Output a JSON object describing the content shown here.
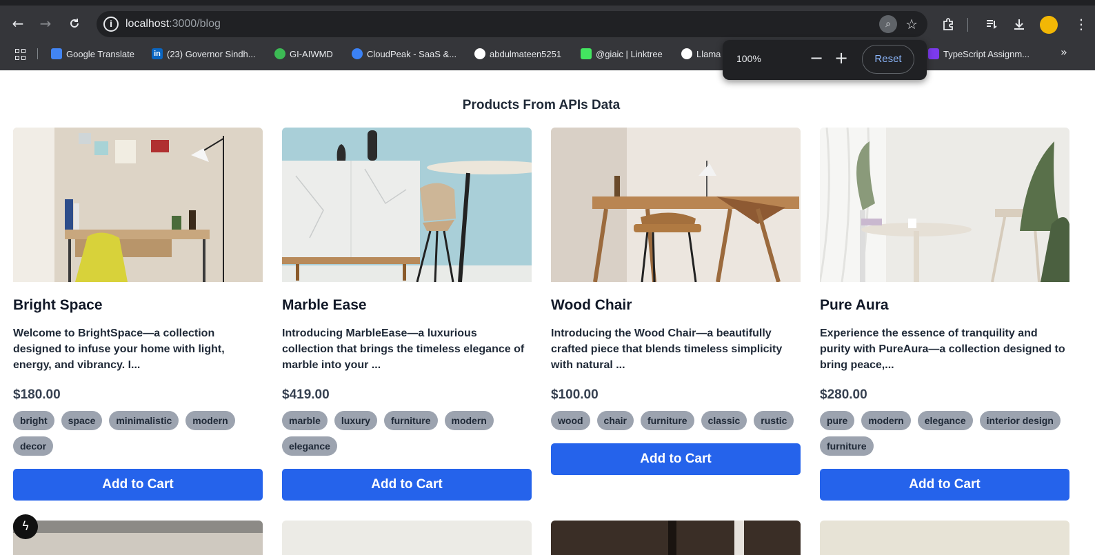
{
  "browser": {
    "url_host": "localhost",
    "url_path": ":3000/blog",
    "nav": {
      "back": "←",
      "forward": "→",
      "reload": "C"
    },
    "toolbar_icons": [
      "zoom-icon",
      "star-icon",
      "extensions-icon",
      "reading-list-icon",
      "download-icon",
      "profile-avatar",
      "menu-icon"
    ],
    "bookmarks": [
      {
        "label": "Google Translate",
        "icon": "google-translate-icon",
        "color": "#4285f4"
      },
      {
        "label": "(23) Governor Sindh...",
        "icon": "linkedin-icon",
        "color": "#0a66c2"
      },
      {
        "label": "GI-AIWMD",
        "icon": "gi-aiwmd-icon",
        "color": "#3cba54"
      },
      {
        "label": "CloudPeak - SaaS &...",
        "icon": "cloudpeak-icon",
        "color": "#3b82f6"
      },
      {
        "label": "abdulmateen5251",
        "icon": "github-icon",
        "color": "#ffffff"
      },
      {
        "label": "@giaic | Linktree",
        "icon": "linktree-icon",
        "color": "#43e660"
      },
      {
        "label": "Llama",
        "icon": "llama-icon",
        "color": "#ffffff"
      },
      {
        "label": "TypeScript Assignm...",
        "icon": "typescript-icon",
        "color": "#7c3aed"
      }
    ],
    "bookmarks_more": "»",
    "zoom_popup": {
      "level": "100%",
      "minus": "−",
      "plus": "+",
      "reset": "Reset"
    }
  },
  "page": {
    "title": "Products From APIs Data"
  },
  "products": [
    {
      "title": "Bright Space",
      "description": "Welcome to BrightSpace—a collection designed to infuse your home with light, energy, and vibrancy. I...",
      "price": "$180.00",
      "tags": [
        "bright",
        "space",
        "minimalistic",
        "modern",
        "decor"
      ],
      "button": "Add to Cart"
    },
    {
      "title": "Marble Ease",
      "description": "Introducing MarbleEase—a luxurious collection that brings the timeless elegance of marble into your ...",
      "price": "$419.00",
      "tags": [
        "marble",
        "luxury",
        "furniture",
        "modern",
        "elegance"
      ],
      "button": "Add to Cart"
    },
    {
      "title": "Wood Chair",
      "description": "Introducing the Wood Chair—a beautifully crafted piece that blends timeless simplicity with natural ...",
      "price": "$100.00",
      "tags": [
        "wood",
        "chair",
        "furniture",
        "classic",
        "rustic"
      ],
      "button": "Add to Cart"
    },
    {
      "title": "Pure Aura",
      "description": "Experience the essence of tranquility and purity with PureAura—a collection designed to bring peace,...",
      "price": "$280.00",
      "tags": [
        "pure",
        "modern",
        "elegance",
        "interior design",
        "furniture"
      ],
      "button": "Add to Cart"
    }
  ],
  "colors": {
    "chrome": "#35363a",
    "button": "#2563eb",
    "tag": "#9ca3af"
  }
}
